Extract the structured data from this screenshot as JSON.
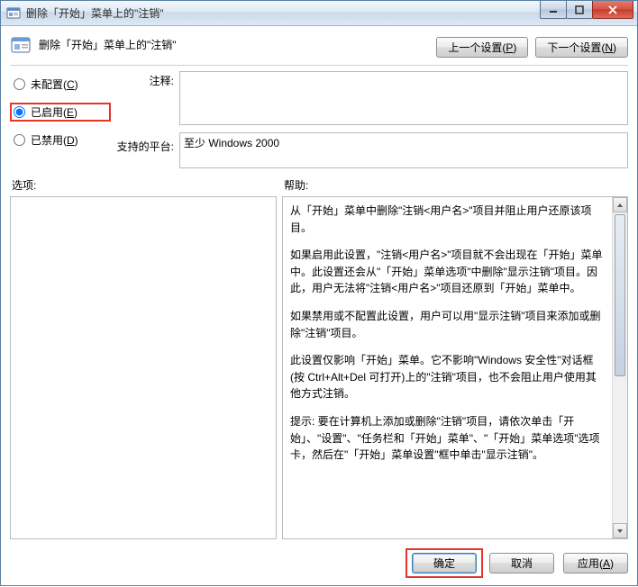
{
  "window": {
    "title": "删除「开始」菜单上的\"注销\""
  },
  "header": {
    "policy_name": "删除「开始」菜单上的\"注销\"",
    "prev_setting": "上一个设置(",
    "prev_accel": "P",
    "prev_suffix": ")",
    "next_setting": "下一个设置(",
    "next_accel": "N",
    "next_suffix": ")"
  },
  "state": {
    "not_configured_label": "未配置(",
    "not_configured_accel": "C",
    "not_configured_suffix": ")",
    "enabled_label": "已启用(",
    "enabled_accel": "E",
    "enabled_suffix": ")",
    "disabled_label": "已禁用(",
    "disabled_accel": "D",
    "disabled_suffix": ")",
    "selected": "enabled"
  },
  "comment_label": "注释:",
  "comment_value": "",
  "platform_label": "支持的平台:",
  "platform_value": "至少 Windows 2000",
  "options_label": "选项:",
  "help_label": "帮助:",
  "help_paragraphs": [
    "从「开始」菜单中删除\"注销<用户名>\"项目并阻止用户还原该项目。",
    "如果启用此设置，\"注销<用户名>\"项目就不会出现在「开始」菜单中。此设置还会从\"「开始」菜单选项\"中删除\"显示注销\"项目。因此，用户无法将\"注销<用户名>\"项目还原到「开始」菜单中。",
    "如果禁用或不配置此设置，用户可以用\"显示注销\"项目来添加或删除\"注销\"项目。",
    "此设置仅影响「开始」菜单。它不影响\"Windows 安全性\"对话框(按 Ctrl+Alt+Del 可打开)上的\"注销\"项目，也不会阻止用户使用其他方式注销。",
    "提示: 要在计算机上添加或删除\"注销\"项目，请依次单击「开始」、\"设置\"、\"任务栏和「开始」菜单\"、\"「开始」菜单选项\"选项卡，然后在\"「开始」菜单设置\"框中单击\"显示注销\"。"
  ],
  "footer": {
    "ok": "确定",
    "cancel": "取消",
    "apply": "应用(",
    "apply_accel": "A",
    "apply_suffix": ")"
  }
}
